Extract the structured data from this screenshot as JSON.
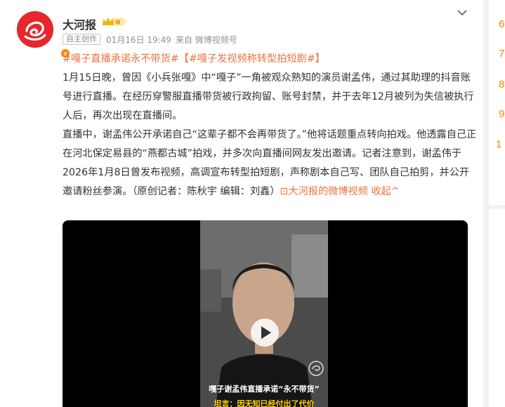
{
  "post": {
    "username": "大河报",
    "badge_label": "III",
    "verified_label": "v",
    "tag": "自主创作",
    "date": "01月16日 19:49",
    "source": "来自 微博视频号",
    "topic1": "#嘎子直播承诺永不带货#",
    "topic2": "【#嘎子发视频称转型拍短剧#】",
    "paragraph1": "1月15日晚，曾因《小兵张嘎》中“嘎子”一角被观众熟知的演员谢孟伟，通过其助理的抖音账号进行直播。在经历穿警服直播带货被行政拘留、账号封禁，并于去年12月被列为失信被执行人后，再次出现在直播间。",
    "paragraph2": "直播中，谢孟伟公开承诺自己“这辈子都不会再带货了。”他将话题重点转向拍戏。他透露自己正在河北保定易县的“燕都古城”拍戏，并多次向直播间网友发出邀请。记者注意到，谢孟伟于2026年1月8日曾发布视频，高调宣布转型拍短剧，声称剧本自己写、团队自己拍剪，并公开邀请粉丝参演。（原创记者：陈秋宇 编辑：刘鑫）",
    "video_link": "⊡大河报的微博视频",
    "collapse": "收起^",
    "video": {
      "caption1": "嘎子谢孟伟直播承诺“永不带货”",
      "caption2": "坦言：因无知已经付出了代价"
    }
  },
  "sidebar": {
    "numbers": [
      "6",
      "7",
      "8",
      "9",
      "1"
    ]
  },
  "colors": {
    "accent": "#eb7340",
    "brand_red": "#e8262d",
    "link": "#eb7340"
  },
  "icons": {
    "avatar": "dahebao-logo",
    "crown": "crown-icon",
    "collapse": "chevron-down-icon",
    "play": "play-icon"
  }
}
